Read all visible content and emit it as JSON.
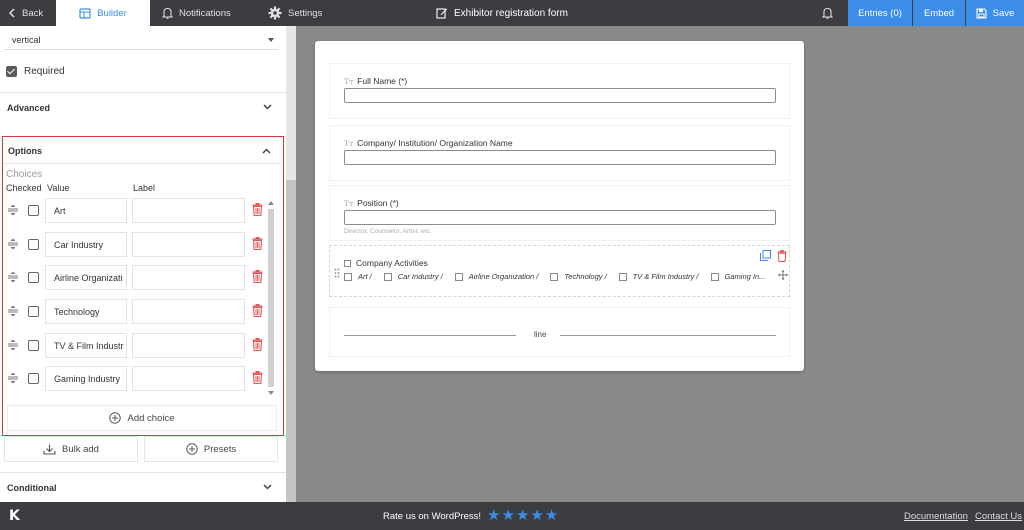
{
  "topbar": {
    "back_label": "Back",
    "builder_label": "Builder",
    "notifications_label": "Notifications",
    "settings_label": "Settings",
    "form_title": "Exhibitor registration form",
    "entries_label": "Entries (0)",
    "embed_label": "Embed",
    "save_label": "Save"
  },
  "panel": {
    "layout_select_value": "vertical",
    "required_label": "Required",
    "advanced_label": "Advanced",
    "options_label": "Options",
    "choices_title": "Choices",
    "col_checked": "Checked",
    "col_value": "Value",
    "col_label": "Label",
    "choices": [
      {
        "value": "Art",
        "label": ""
      },
      {
        "value": "Car Industry",
        "label": ""
      },
      {
        "value": "Airline Organizati",
        "label": ""
      },
      {
        "value": "Technology",
        "label": ""
      },
      {
        "value": "TV & Film Industr",
        "label": ""
      },
      {
        "value": "Gaming Industry",
        "label": ""
      }
    ],
    "add_choice_label": "Add choice",
    "bulk_add_label": "Bulk add",
    "presets_label": "Presets",
    "conditional_label": "Conditional"
  },
  "form": {
    "fields": [
      {
        "label": "Full Name (*)",
        "help": ""
      },
      {
        "label": "Company/ Institution/ Organization Name",
        "help": ""
      },
      {
        "label": "Position (*)",
        "help": "Director, Counselor, Artist, etc."
      }
    ],
    "company_activities": {
      "label": "Company Activities",
      "options": [
        "Art /",
        "Car Industry /",
        "Airline Organization /",
        "Technology /",
        "TV & Film Industry /",
        "Gaming In..."
      ]
    },
    "divider_label": "line"
  },
  "footer": {
    "rate_label": "Rate us on WordPress!",
    "stars": 5,
    "documentation_label": "Documentation",
    "contact_label": "Contact Us"
  },
  "colors": {
    "accent": "#3b8de8",
    "topbar_bg": "#3b3d40",
    "highlight_border": "#d23a3a",
    "trash_red": "#e05555"
  }
}
